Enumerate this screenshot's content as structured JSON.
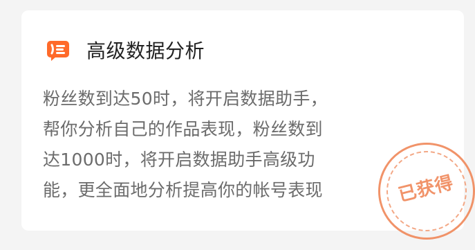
{
  "card": {
    "icon": "chart-comment-icon",
    "title": "高级数据分析",
    "description": "粉丝数到达50时，将开启数据助手，\n帮你分析自己的作品表现，粉丝数到\n达1000时，将开启数据助手高级功\n能，更全面地分析提高你的帐号表现",
    "status_stamp": "已获得"
  },
  "colors": {
    "accent": "#ff6a2a",
    "stamp": "#f08a5d",
    "title": "#222222",
    "text": "#6b6b6b"
  }
}
